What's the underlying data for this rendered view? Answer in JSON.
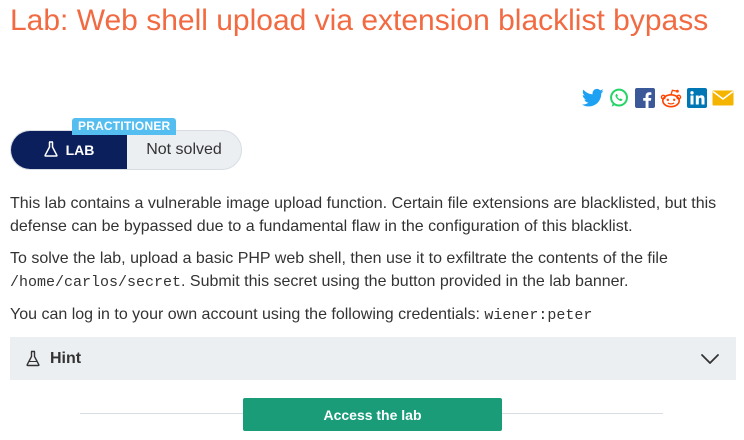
{
  "header": {
    "title": "Lab: Web shell upload via extension blacklist bypass"
  },
  "share": {
    "icons": [
      "twitter-icon",
      "whatsapp-icon",
      "facebook-icon",
      "reddit-icon",
      "linkedin-icon",
      "email-icon"
    ],
    "colors": {
      "twitter": "#1da1f2",
      "whatsapp": "#25d366",
      "facebook": "#3b5998",
      "reddit": "#ff4500",
      "linkedin": "#0077b5",
      "email": "#f5b400"
    }
  },
  "lab_badge": {
    "level": "PRACTITIONER",
    "type_label": "LAB",
    "status": "Not solved",
    "level_color": "#55bef0",
    "badge_color": "#0b1f5c"
  },
  "description": {
    "p1": "This lab contains a vulnerable image upload function. Certain file extensions are blacklisted, but this defense can be bypassed due to a fundamental flaw in the configuration of this blacklist.",
    "p2_before": "To solve the lab, upload a basic PHP web shell, then use it to exfiltrate the contents of the file",
    "p2_code": "/home/carlos/secret",
    "p2_after": ". Submit this secret using the button provided in the lab banner.",
    "p3_text": "You can log in to your own account using the following credentials:",
    "p3_code": "wiener:peter"
  },
  "hint": {
    "label": "Hint"
  },
  "actions": {
    "access_label": "Access the lab",
    "access_color": "#1a9c79"
  },
  "colors": {
    "accent": "#f26a41"
  }
}
